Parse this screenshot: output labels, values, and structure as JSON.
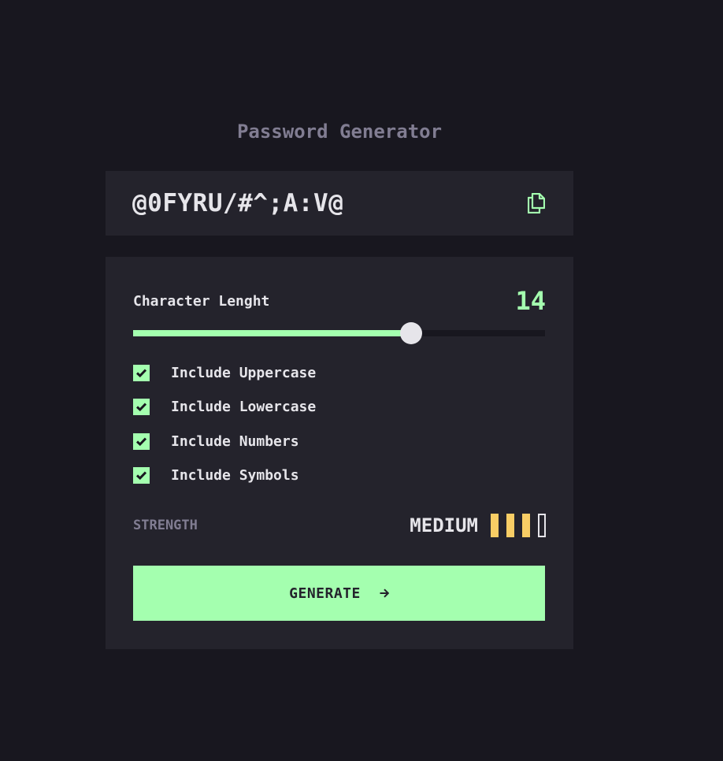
{
  "title": "Password Generator",
  "password": {
    "value": "@0FYRU/#^;A:V@",
    "copy_icon": "copy-icon"
  },
  "length": {
    "label": "Character Lenght",
    "value": "14",
    "slider_fraction": 0.675
  },
  "options": [
    {
      "label": "Include Uppercase",
      "checked": true
    },
    {
      "label": "Include Lowercase",
      "checked": true
    },
    {
      "label": "Include Numbers",
      "checked": true
    },
    {
      "label": "Include Symbols",
      "checked": true
    }
  ],
  "strength": {
    "label": "STRENGTH",
    "value": "MEDIUM",
    "level": 3,
    "max_level": 4
  },
  "generate": {
    "label": "GENERATE",
    "icon": "arrow-right-icon"
  },
  "colors": {
    "background": "#18171f",
    "panel": "#24232c",
    "accent": "#a4ffaf",
    "strength_medium": "#f8cd65",
    "text": "#e6e5ea",
    "muted": "#817d92"
  }
}
